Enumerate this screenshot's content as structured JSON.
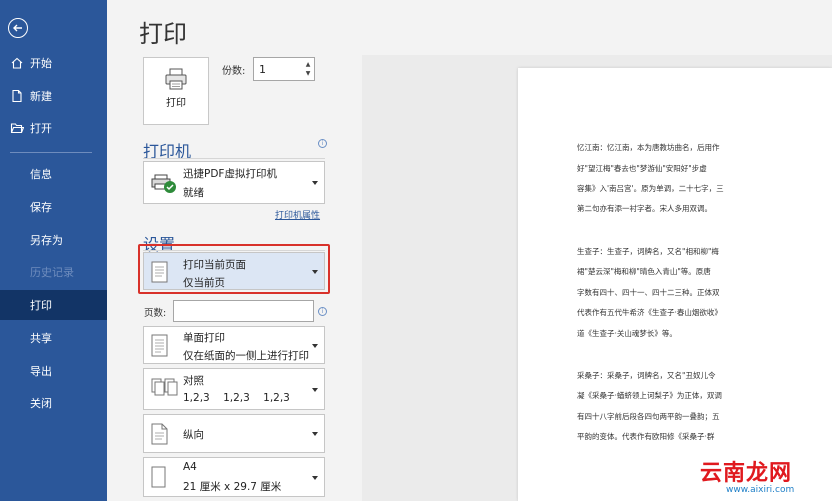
{
  "sidebar": {
    "items": [
      {
        "label": "开始",
        "icon": "home-icon"
      },
      {
        "label": "新建",
        "icon": "new-document-icon"
      },
      {
        "label": "打开",
        "icon": "open-folder-icon"
      },
      {
        "label": "信息"
      },
      {
        "label": "保存"
      },
      {
        "label": "另存为"
      },
      {
        "label": "历史记录"
      },
      {
        "label": "打印"
      },
      {
        "label": "共享"
      },
      {
        "label": "导出"
      },
      {
        "label": "关闭"
      }
    ],
    "active": "打印"
  },
  "main": {
    "title": "打印",
    "print_button": "打印",
    "copies_label": "份数:",
    "copies_value": "1",
    "printer_heading": "打印机",
    "printer_name": "迅捷PDF虚拟打印机",
    "printer_status": "就绪",
    "printer_properties": "打印机属性",
    "settings_heading": "设置",
    "range_l1": "打印当前页面",
    "range_l2": "仅当前页",
    "pages_label": "页数:",
    "pages_value": "",
    "sides_l1": "单面打印",
    "sides_l2": "仅在纸面的一侧上进行打印",
    "collate_l1": "对照",
    "collate_l2": "1,2,3    1,2,3    1,2,3",
    "orientation_l1": "纵向",
    "paper_l1": "A4",
    "paper_l2": "21 厘米 x 29.7 厘米"
  },
  "preview": {
    "lines": [
      "忆江南：忆江南，本为唐教坊曲名，后用作",
      "好\"望江梅\"春去也\"梦游仙\"安阳好\"步虚",
      "容集》入'南吕宫'。原为单调，二十七字，三",
      "第二句亦有添一衬字者。宋人多用双调。",
      "生查子：生查子，词牌名，又名\"相和柳\"梅",
      "裙\"楚云深\"梅和柳\"晴色入青山\"等。原唐",
      "字数有四十、四十一、四十二三种。正体双",
      "代表作有五代牛希济《生查子·春山烟欲收》",
      "道《生查子·关山魂梦长》等。",
      "采桑子：采桑子，词牌名，又名\"丑奴儿令",
      "凝《采桑子·蝤蛴领上诃梨子》为正体，双调",
      "有四十八字前后段各四句两平韵一叠韵；五",
      "平韵的变体。代表作有欧阳修《采桑子·群"
    ]
  },
  "watermark": {
    "main": "云南龙网",
    "url": "www.aixiri.com"
  }
}
